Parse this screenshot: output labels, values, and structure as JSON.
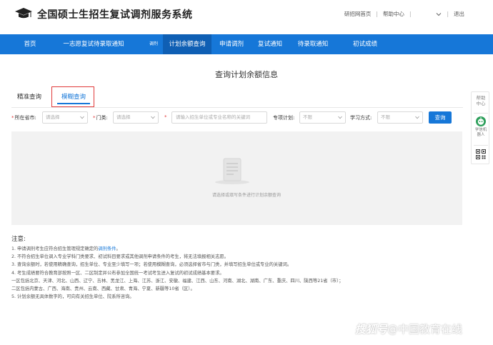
{
  "header": {
    "site_title": "全国硕士生招生复试调剂服务系统",
    "links": [
      "研招网首页",
      "帮助中心",
      "退出"
    ]
  },
  "nav": {
    "items": [
      "首页",
      "一志愿复试待录取通知",
      "调剂",
      "计划余额查询",
      "申请调剂",
      "复试通知",
      "待录取通知",
      "初试成绩"
    ],
    "active": "计划余额查询"
  },
  "main": {
    "title": "查询计划余额信息",
    "tabs": [
      "精准查询",
      "模糊查询"
    ],
    "active_tab": "模糊查询"
  },
  "filters": {
    "province_label": "所在省市:",
    "province_value": "请选择",
    "category_label": "门类:",
    "category_value": "请选择",
    "keyword_placeholder": "请输入招生单位或专业名称的关键词",
    "special_plan_label": "专项计划:",
    "special_plan_value": "不限",
    "study_mode_label": "学习方式:",
    "study_mode_value": "不限",
    "query_label": "查询"
  },
  "empty_state": {
    "text": "请选择或填写条件进行计划余额查询"
  },
  "notes": {
    "title": "注意:",
    "line1_prefix": "1. 申请调剂考生应符合招生管理规定确定的",
    "line1_link": "调剂条件",
    "line1_suffix": "。",
    "lines": [
      "2. 不符合招生单位调入专业学科门类要求、初试科目要求或其他调剂申请条件的考生，将无法填报相关志愿。",
      "3. 查询余额时，若使用精确查询，招生单位、专业至少填写一项；若使用模糊查询，必须选择省市与门类，并填写招生单位或专业的关键词。",
      "4. 考生成绩要符合教育部按照一区、二区制定并公布参加全国统一考试考生进入复试的初试成绩基本要求。",
      "一区包括北京、天津、河北、山西、辽宁、吉林、黑龙江、上海、江苏、浙江、安徽、福建、江西、山东、河南、湖北、湖南、广东、重庆、四川、陕西等21省（市）；",
      "二区包括内蒙古、广西、海南、贵州、云南、西藏、甘肃、青海、宁夏、新疆等10省（区）。",
      "5. 计划余额无具体数字的，可向有关招生单位、院系所咨询。"
    ]
  },
  "side_bar": {
    "help_label": "帮助中心",
    "robot_label": "学信机器人"
  },
  "watermark": {
    "brand": "搜狐号",
    "text": "@中国教育在线"
  },
  "colors": {
    "primary": "#1677d8",
    "nav_active": "#0f5fb4",
    "highlight_border": "#e03a3a",
    "empty_bg": "#f2f2f2"
  },
  "icons": {
    "logo": "graduation-cap-icon",
    "dropdown": "chevron-down-icon",
    "empty": "document-icon",
    "robot": "robot-icon",
    "qr": "qr-code-icon"
  }
}
